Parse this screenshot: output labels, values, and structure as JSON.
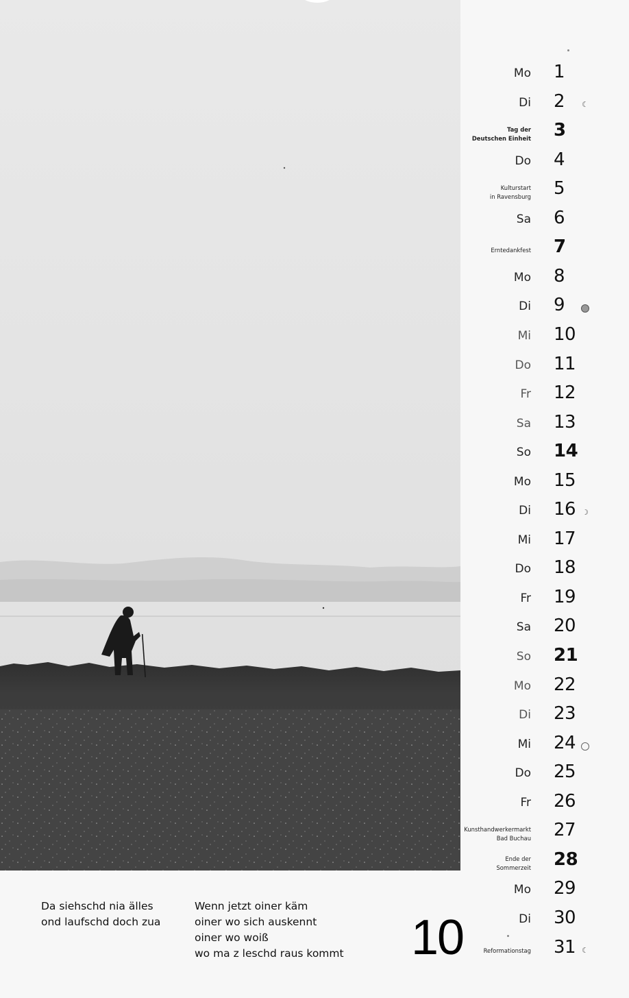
{
  "calendar": {
    "month_number": "10",
    "days": [
      {
        "n": "1",
        "wd": "Mo",
        "note": "",
        "bold": false,
        "moon": ""
      },
      {
        "n": "2",
        "wd": "Di",
        "note": "",
        "bold": false,
        "moon": "waning"
      },
      {
        "n": "3",
        "wd": "",
        "note": "Tag der\nDeutschen Einheit",
        "bold": true,
        "moon": ""
      },
      {
        "n": "4",
        "wd": "Do",
        "note": "",
        "bold": false,
        "moon": ""
      },
      {
        "n": "5",
        "wd": "",
        "note": "Kulturstart\nin Ravensburg",
        "bold": false,
        "moon": ""
      },
      {
        "n": "6",
        "wd": "Sa",
        "note": "",
        "bold": false,
        "moon": ""
      },
      {
        "n": "7",
        "wd": "",
        "note": "Erntedankfest",
        "bold": true,
        "moon": ""
      },
      {
        "n": "8",
        "wd": "Mo",
        "note": "",
        "bold": false,
        "moon": ""
      },
      {
        "n": "9",
        "wd": "Di",
        "note": "",
        "bold": false,
        "moon": "new"
      },
      {
        "n": "10",
        "wd": "Mi",
        "note": "",
        "bold": false,
        "moon": ""
      },
      {
        "n": "11",
        "wd": "Do",
        "note": "",
        "bold": false,
        "moon": ""
      },
      {
        "n": "12",
        "wd": "Fr",
        "note": "",
        "bold": false,
        "moon": ""
      },
      {
        "n": "13",
        "wd": "Sa",
        "note": "",
        "bold": false,
        "moon": ""
      },
      {
        "n": "14",
        "wd": "So",
        "note": "",
        "bold": true,
        "moon": ""
      },
      {
        "n": "15",
        "wd": "Mo",
        "note": "",
        "bold": false,
        "moon": ""
      },
      {
        "n": "16",
        "wd": "Di",
        "note": "",
        "bold": false,
        "moon": "waxing"
      },
      {
        "n": "17",
        "wd": "Mi",
        "note": "",
        "bold": false,
        "moon": ""
      },
      {
        "n": "18",
        "wd": "Do",
        "note": "",
        "bold": false,
        "moon": ""
      },
      {
        "n": "19",
        "wd": "Fr",
        "note": "",
        "bold": false,
        "moon": ""
      },
      {
        "n": "20",
        "wd": "Sa",
        "note": "",
        "bold": false,
        "moon": ""
      },
      {
        "n": "21",
        "wd": "So",
        "note": "",
        "bold": true,
        "moon": ""
      },
      {
        "n": "22",
        "wd": "Mo",
        "note": "",
        "bold": false,
        "moon": ""
      },
      {
        "n": "23",
        "wd": "Di",
        "note": "",
        "bold": false,
        "moon": ""
      },
      {
        "n": "24",
        "wd": "Mi",
        "note": "",
        "bold": false,
        "moon": "full"
      },
      {
        "n": "25",
        "wd": "Do",
        "note": "",
        "bold": false,
        "moon": ""
      },
      {
        "n": "26",
        "wd": "Fr",
        "note": "",
        "bold": false,
        "moon": ""
      },
      {
        "n": "27",
        "wd": "",
        "note": "Kunsthandwerkermarkt\nBad  Buchau",
        "bold": false,
        "moon": ""
      },
      {
        "n": "28",
        "wd": "",
        "note": "Ende der\nSommerzeit",
        "bold": true,
        "moon": ""
      },
      {
        "n": "29",
        "wd": "Mo",
        "note": "",
        "bold": false,
        "moon": ""
      },
      {
        "n": "30",
        "wd": "Di",
        "note": "",
        "bold": false,
        "moon": ""
      },
      {
        "n": "31",
        "wd": "",
        "note": "Reformationstag",
        "bold": false,
        "moon": "waning"
      }
    ]
  },
  "poem": {
    "left_lines": [
      "Da siehschd nia älles",
      "ond laufschd doch zua"
    ],
    "right_lines": [
      "Wenn jetzt oiner käm",
      "oiner wo sich auskennt",
      "oiner wo woiß",
      "wo ma z leschd raus kommt"
    ]
  },
  "icons": {
    "moon_waning": "moon-waning-icon",
    "moon_waxing": "moon-waxing-icon",
    "moon_new": "moon-new-icon",
    "moon_full": "moon-full-icon"
  },
  "colors": {
    "paper": "#f7f7f7",
    "ink": "#111111",
    "field_dark": "#3a3a3a"
  }
}
